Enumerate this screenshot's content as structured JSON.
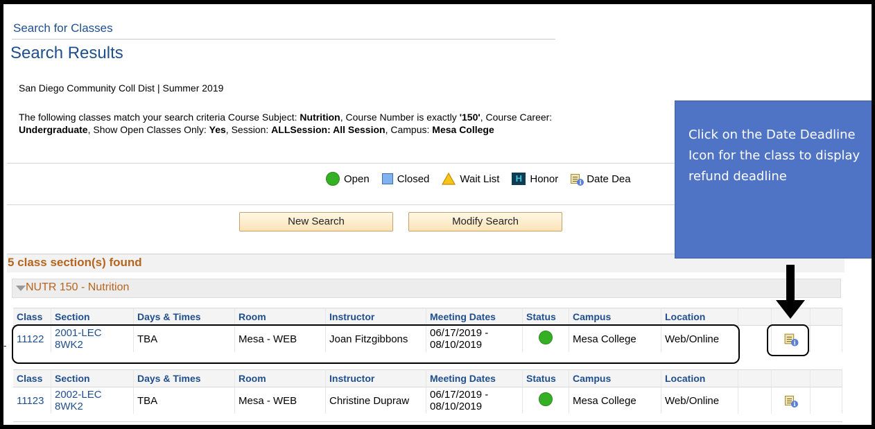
{
  "breadcrumb": "Search for Classes",
  "page_title": "Search Results",
  "institution": "San Diego Community Coll Dist | Summer 2019",
  "criteria": {
    "t1": "The following classes match your search criteria Course Subject: ",
    "subject": "Nutrition",
    "t2": ",  Course Number is exactly ",
    "number": "'150'",
    "t3": ",  Course Career: ",
    "career": "Undergraduate",
    "t4": ",  Show Open Classes Only: ",
    "open_only": "Yes",
    "t5": ",  Session: ",
    "session": "ALLSession: All Session",
    "t6": ",  Campus: ",
    "campus": "Mesa College"
  },
  "legend": {
    "open": "Open",
    "closed": "Closed",
    "wait": "Wait List",
    "honor": "Honor",
    "date": "Date Dea"
  },
  "buttons": {
    "new_search": "New Search",
    "modify_search": "Modify Search"
  },
  "found": "5 class section(s) found",
  "course_title": "NUTR 150 - Nutrition",
  "columns": [
    "Class",
    "Section",
    "Days & Times",
    "Room",
    "Instructor",
    "Meeting Dates",
    "Status",
    "Campus",
    "Location"
  ],
  "rows": [
    {
      "class": "11122",
      "section": "2001-LEC 8WK2",
      "days": "TBA",
      "room": "Mesa - WEB",
      "instructor": "Joan Fitzgibbons",
      "dates": "06/17/2019 - 08/10/2019",
      "campus": "Mesa College",
      "location": "Web/Online"
    },
    {
      "class": "11123",
      "section": "2002-LEC 8WK2",
      "days": "TBA",
      "room": "Mesa - WEB",
      "instructor": "Christine Dupraw",
      "dates": "06/17/2019 - 08/10/2019",
      "campus": "Mesa College",
      "location": "Web/Online"
    }
  ],
  "callout": "Click on the Date Deadline Icon for the class to display refund deadline",
  "margin_tick": "-",
  "colors": {
    "title_blue": "#1f4e8c",
    "found_orange": "#b5651d",
    "callout_blue": "#4f74c6",
    "status_open": "#35b024"
  }
}
